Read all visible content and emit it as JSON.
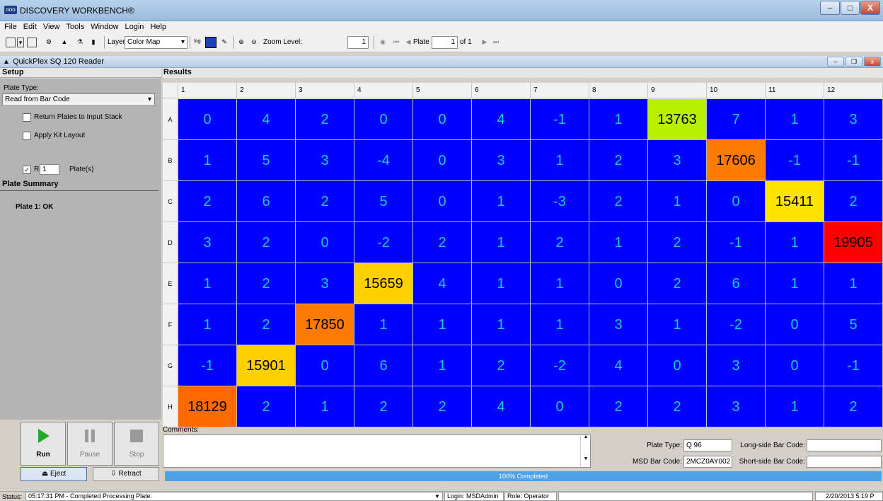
{
  "window": {
    "title": "DISCOVERY WORKBENCH®",
    "app_icon": "ooo",
    "minimize": "–",
    "maximize": "□",
    "close": "X"
  },
  "menu": [
    "File",
    "Edit",
    "View",
    "Tools",
    "Window",
    "Login",
    "Help"
  ],
  "toolbar": {
    "layer_label": "Layer:",
    "layer_value": "Color Map",
    "zoom_label": "Zoom Level:",
    "zoom_value": "1",
    "plate_label": "Plate",
    "plate_value": "1",
    "plate_of": "of 1"
  },
  "doc": {
    "title": "QuickPlex SQ 120 Reader"
  },
  "setup": {
    "header": "Setup",
    "plate_type_label": "Plate Type:",
    "plate_type_value": "Read from Bar Code",
    "options": [
      {
        "label": "Return Plates to Input Stack",
        "checked": false
      },
      {
        "label": "Apply Kit Layout",
        "checked": false
      }
    ],
    "read_label": "Read",
    "read_checked": true,
    "read_count": "1",
    "plates_label": "Plate(s)",
    "summary_header": "Plate Summary",
    "summary_item": "Plate 1:  OK"
  },
  "controls": {
    "run": "Run",
    "pause": "Pause",
    "stop": "Stop",
    "eject": "Eject",
    "retract": "Retract"
  },
  "results": {
    "header": "Results",
    "columns": [
      "1",
      "2",
      "3",
      "4",
      "5",
      "6",
      "7",
      "8",
      "9",
      "10",
      "11",
      "12"
    ],
    "rows": [
      "A",
      "B",
      "C",
      "D",
      "E",
      "F",
      "G",
      "H"
    ],
    "values": [
      [
        "0",
        "4",
        "2",
        "0",
        "0",
        "4",
        "-1",
        "1",
        "13763",
        "7",
        "1",
        "3"
      ],
      [
        "1",
        "5",
        "3",
        "-4",
        "0",
        "3",
        "1",
        "2",
        "3",
        "17606",
        "-1",
        "-1"
      ],
      [
        "2",
        "6",
        "2",
        "5",
        "0",
        "1",
        "-3",
        "2",
        "1",
        "0",
        "15411",
        "2"
      ],
      [
        "3",
        "2",
        "0",
        "-2",
        "2",
        "1",
        "2",
        "1",
        "2",
        "-1",
        "1",
        "19905"
      ],
      [
        "1",
        "2",
        "3",
        "15659",
        "4",
        "1",
        "1",
        "0",
        "2",
        "6",
        "1",
        "1"
      ],
      [
        "1",
        "2",
        "17850",
        "1",
        "1",
        "1",
        "1",
        "3",
        "1",
        "-2",
        "0",
        "5"
      ],
      [
        "-1",
        "15901",
        "0",
        "6",
        "1",
        "2",
        "-2",
        "4",
        "0",
        "3",
        "0",
        "-1"
      ],
      [
        "18129",
        "2",
        "1",
        "2",
        "2",
        "4",
        "0",
        "2",
        "2",
        "3",
        "1",
        "2"
      ]
    ],
    "high_colors": {
      "13763": "#b8f000",
      "17606": "#ff7a00",
      "15411": "#ffe400",
      "19905": "#ff0000",
      "15659": "#ffd000",
      "17850": "#ff7a00",
      "15901": "#ffd000",
      "18129": "#ff6a00"
    },
    "low_color": "#0000ff",
    "low_text_color": "#1fc8d8"
  },
  "comments": {
    "label": "Comments:",
    "value": ""
  },
  "plate_info": {
    "plate_type_label": "Plate Type:",
    "plate_type_value": "Q 96",
    "msd_bar_code_label": "MSD Bar Code:",
    "msd_bar_code_value": "2MCZ0AY002",
    "long_side_label": "Long-side Bar Code:",
    "long_side_value": "",
    "short_side_label": "Short-side Bar Code:",
    "short_side_value": ""
  },
  "progress": {
    "text": "100% Completed",
    "percent": 100
  },
  "status": {
    "label": "Status:",
    "message": "05:17:31 PM - Completed Processing Plate.",
    "login": "Login: MSDAdmin",
    "role": "Role: Operator",
    "datetime": "2/20/2013 5:19 P"
  }
}
